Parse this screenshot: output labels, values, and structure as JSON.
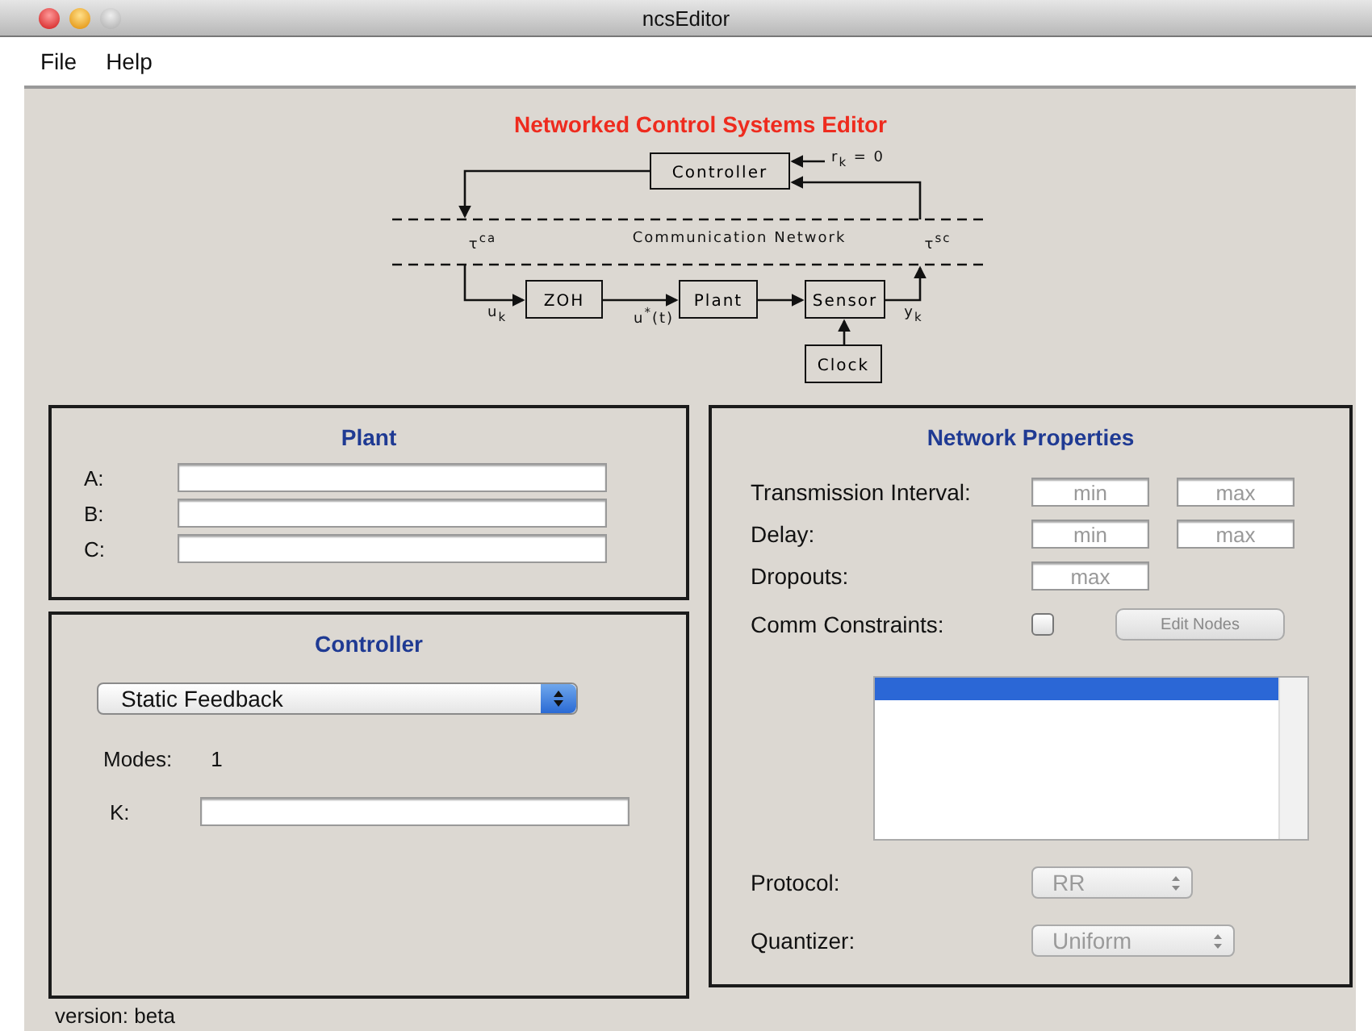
{
  "window": {
    "title": "ncsEditor"
  },
  "menu": [
    {
      "label": "File"
    },
    {
      "label": "Help"
    }
  ],
  "heading": "Networked Control Systems Editor",
  "diagram": {
    "blocks": [
      {
        "label": "Controller"
      },
      {
        "label": "ZOH"
      },
      {
        "label": "Plant"
      },
      {
        "label": "Sensor"
      },
      {
        "label": "Clock"
      }
    ],
    "labels": [
      {
        "text": "r$_{k}$ = 0"
      },
      {
        "text": "τ$^{ca}$"
      },
      {
        "text": "Communication Network"
      },
      {
        "text": "τ$^{sc}$"
      },
      {
        "text": "u$_{k}$"
      },
      {
        "text": "u$^{*}$(t)"
      },
      {
        "text": "y$_{k}$"
      }
    ]
  },
  "plant": {
    "title": "Plant",
    "fields": [
      {
        "label": "A:"
      },
      {
        "label": "B:"
      },
      {
        "label": "C:"
      }
    ]
  },
  "controller": {
    "title": "Controller",
    "type_select": {
      "value": "Static Feedback"
    },
    "modes_label": "Modes:",
    "modes_value": "1",
    "gain": {
      "label": "K:"
    }
  },
  "network": {
    "title": "Network Properties",
    "rows": [
      {
        "label": "Transmission Interval:",
        "fields": [
          {
            "placeholder": "min"
          },
          {
            "placeholder": "max"
          }
        ]
      },
      {
        "label": "Delay:",
        "fields": [
          {
            "placeholder": "min"
          },
          {
            "placeholder": "max"
          }
        ]
      },
      {
        "label": "Dropouts:",
        "fields": [
          {
            "placeholder": "max"
          }
        ]
      }
    ],
    "constraints": {
      "label": "Comm Constraints:",
      "checked": false,
      "button": {
        "label": "Edit Nodes",
        "disabled": true
      }
    },
    "node_list": {
      "rows": [
        {
          "selected": true
        }
      ]
    },
    "protocol": {
      "label": "Protocol:",
      "value": "RR",
      "disabled": true
    },
    "quantizer": {
      "label": "Quantizer:",
      "value": "Uniform",
      "disabled": true
    }
  },
  "status": "version: beta"
}
